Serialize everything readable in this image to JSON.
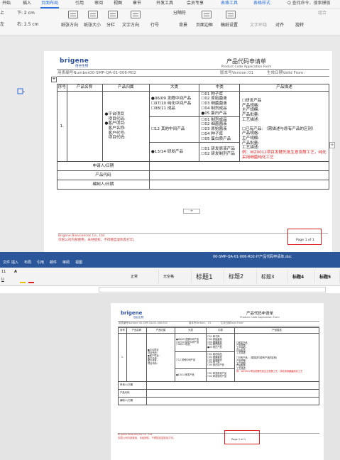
{
  "wps": {
    "tabs": [
      "开始",
      "插入",
      "页面布局",
      "引用",
      "审阅",
      "视图",
      "章节",
      "开发工具",
      "会员专享",
      "表格工具",
      "表格样式"
    ],
    "active_tab": "页面布局",
    "search_placeholder": "Q 查找命令、搜索模板",
    "toolbar": {
      "margin_down": "下: 2 cm",
      "margin_right": "右: 2.5 cm",
      "orientation": "纸张方向",
      "size": "纸张大小",
      "columns": "分栏",
      "text_direction": "文字方向",
      "line_no": "行号",
      "section_break": "分隔符",
      "background": "背景",
      "page_border": "页面边框",
      "draft": "稿纸设置",
      "wrap": "文字环绕",
      "align": "对齐",
      "rotate": "旋转",
      "group": "组合",
      "partial_labels": [
        "上",
        "左"
      ]
    },
    "document": {
      "logo": "brigene",
      "logo_sub": "倍谷生物",
      "title_cn": "产品代码申请单",
      "title_en": "Product Code Application Form",
      "form_no_label": "用表编号Number:",
      "form_no": "00-SMP-QA-01-006-R02",
      "version_label": "版本号Version:",
      "version": "01",
      "date_label": "生效日期Valid From:",
      "headers": [
        "序号",
        "产品名称",
        "产品归属",
        "大类",
        "中类",
        "产品描述"
      ],
      "row_no": "1.",
      "ownership": [
        "●平台项目",
        "项目代码:",
        "●客户项目:",
        "客户名称:",
        "客户代号:",
        "项目代码:"
      ],
      "categories": [
        {
          "big": [
            "●06/09 发酵中间产品",
            "☐07/10 纯化中间产品",
            "☐08/11 成品"
          ],
          "mid": [
            "☐01 种子库",
            "☐02 原始菌液",
            "☐03 细菌菌液",
            "☐04 制剂成品",
            "●05 蛋白产品"
          ]
        },
        {
          "big": [
            "☐12 其他中间产品"
          ],
          "mid": [
            "☐01 制剂成品",
            "☐02 细菌菌液",
            "☐03 原始菌液",
            "☐04 种子库",
            "☐05 蛋白质产品"
          ]
        },
        {
          "big": [
            "●13/14 研发产品"
          ],
          "mid": [
            "☐01 研发原液产品",
            "☐02 研发制剂产品"
          ]
        }
      ],
      "desc_a": [
        "☐研发产品",
        "产品规格:",
        "主产规模:",
        "产品批量:",
        "工艺描述:"
      ],
      "desc_b_head": "☐已有产品: （需描述与原有产品的区别）",
      "desc_b": [
        "产品规格:",
        "主产规模:",
        "产品批量:",
        "工艺描述:"
      ],
      "desc_red": "例：WZ0012项目发酵先批生意发酵工艺，纯化采用细菌纯化工艺",
      "signature_rows": [
        "申请人/日期",
        "产品代码",
        "编制人/日期"
      ],
      "footer_company": "Brigene Biosciences Co., Ltd.",
      "footer_note": "仅限公司内部使用，未经授权，不得擅自复制及打印。",
      "page_label": "Page 1 of 1"
    }
  },
  "word": {
    "title": "00-SMP-QA-01-006-R02-IY产品代码申请单.doc",
    "tabs": [
      "文件",
      "插入",
      "布局",
      "引用",
      "邮件",
      "审阅",
      "视图"
    ],
    "styles": [
      "正常",
      "无空格",
      "标题1",
      "标题2",
      "标题3",
      "标题4",
      "标题5"
    ],
    "font_size": "11",
    "accent": "#2b579a",
    "highlight_color": "#e02020"
  }
}
